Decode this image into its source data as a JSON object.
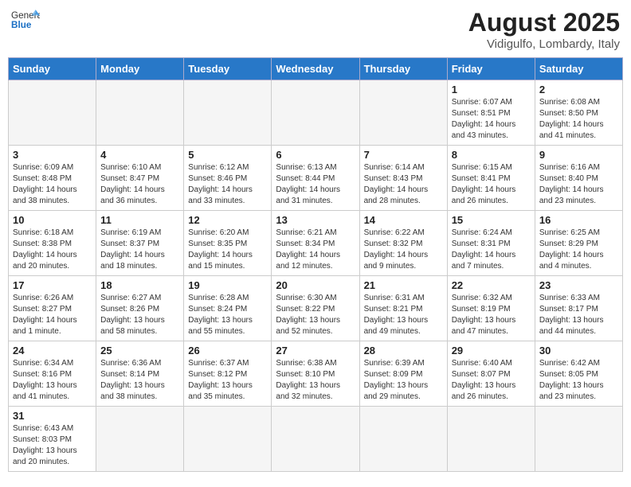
{
  "header": {
    "logo_general": "General",
    "logo_blue": "Blue",
    "title": "August 2025",
    "subtitle": "Vidigulfo, Lombardy, Italy"
  },
  "weekdays": [
    "Sunday",
    "Monday",
    "Tuesday",
    "Wednesday",
    "Thursday",
    "Friday",
    "Saturday"
  ],
  "weeks": [
    [
      {
        "day": "",
        "info": ""
      },
      {
        "day": "",
        "info": ""
      },
      {
        "day": "",
        "info": ""
      },
      {
        "day": "",
        "info": ""
      },
      {
        "day": "",
        "info": ""
      },
      {
        "day": "1",
        "info": "Sunrise: 6:07 AM\nSunset: 8:51 PM\nDaylight: 14 hours and 43 minutes."
      },
      {
        "day": "2",
        "info": "Sunrise: 6:08 AM\nSunset: 8:50 PM\nDaylight: 14 hours and 41 minutes."
      }
    ],
    [
      {
        "day": "3",
        "info": "Sunrise: 6:09 AM\nSunset: 8:48 PM\nDaylight: 14 hours and 38 minutes."
      },
      {
        "day": "4",
        "info": "Sunrise: 6:10 AM\nSunset: 8:47 PM\nDaylight: 14 hours and 36 minutes."
      },
      {
        "day": "5",
        "info": "Sunrise: 6:12 AM\nSunset: 8:46 PM\nDaylight: 14 hours and 33 minutes."
      },
      {
        "day": "6",
        "info": "Sunrise: 6:13 AM\nSunset: 8:44 PM\nDaylight: 14 hours and 31 minutes."
      },
      {
        "day": "7",
        "info": "Sunrise: 6:14 AM\nSunset: 8:43 PM\nDaylight: 14 hours and 28 minutes."
      },
      {
        "day": "8",
        "info": "Sunrise: 6:15 AM\nSunset: 8:41 PM\nDaylight: 14 hours and 26 minutes."
      },
      {
        "day": "9",
        "info": "Sunrise: 6:16 AM\nSunset: 8:40 PM\nDaylight: 14 hours and 23 minutes."
      }
    ],
    [
      {
        "day": "10",
        "info": "Sunrise: 6:18 AM\nSunset: 8:38 PM\nDaylight: 14 hours and 20 minutes."
      },
      {
        "day": "11",
        "info": "Sunrise: 6:19 AM\nSunset: 8:37 PM\nDaylight: 14 hours and 18 minutes."
      },
      {
        "day": "12",
        "info": "Sunrise: 6:20 AM\nSunset: 8:35 PM\nDaylight: 14 hours and 15 minutes."
      },
      {
        "day": "13",
        "info": "Sunrise: 6:21 AM\nSunset: 8:34 PM\nDaylight: 14 hours and 12 minutes."
      },
      {
        "day": "14",
        "info": "Sunrise: 6:22 AM\nSunset: 8:32 PM\nDaylight: 14 hours and 9 minutes."
      },
      {
        "day": "15",
        "info": "Sunrise: 6:24 AM\nSunset: 8:31 PM\nDaylight: 14 hours and 7 minutes."
      },
      {
        "day": "16",
        "info": "Sunrise: 6:25 AM\nSunset: 8:29 PM\nDaylight: 14 hours and 4 minutes."
      }
    ],
    [
      {
        "day": "17",
        "info": "Sunrise: 6:26 AM\nSunset: 8:27 PM\nDaylight: 14 hours and 1 minute."
      },
      {
        "day": "18",
        "info": "Sunrise: 6:27 AM\nSunset: 8:26 PM\nDaylight: 13 hours and 58 minutes."
      },
      {
        "day": "19",
        "info": "Sunrise: 6:28 AM\nSunset: 8:24 PM\nDaylight: 13 hours and 55 minutes."
      },
      {
        "day": "20",
        "info": "Sunrise: 6:30 AM\nSunset: 8:22 PM\nDaylight: 13 hours and 52 minutes."
      },
      {
        "day": "21",
        "info": "Sunrise: 6:31 AM\nSunset: 8:21 PM\nDaylight: 13 hours and 49 minutes."
      },
      {
        "day": "22",
        "info": "Sunrise: 6:32 AM\nSunset: 8:19 PM\nDaylight: 13 hours and 47 minutes."
      },
      {
        "day": "23",
        "info": "Sunrise: 6:33 AM\nSunset: 8:17 PM\nDaylight: 13 hours and 44 minutes."
      }
    ],
    [
      {
        "day": "24",
        "info": "Sunrise: 6:34 AM\nSunset: 8:16 PM\nDaylight: 13 hours and 41 minutes."
      },
      {
        "day": "25",
        "info": "Sunrise: 6:36 AM\nSunset: 8:14 PM\nDaylight: 13 hours and 38 minutes."
      },
      {
        "day": "26",
        "info": "Sunrise: 6:37 AM\nSunset: 8:12 PM\nDaylight: 13 hours and 35 minutes."
      },
      {
        "day": "27",
        "info": "Sunrise: 6:38 AM\nSunset: 8:10 PM\nDaylight: 13 hours and 32 minutes."
      },
      {
        "day": "28",
        "info": "Sunrise: 6:39 AM\nSunset: 8:09 PM\nDaylight: 13 hours and 29 minutes."
      },
      {
        "day": "29",
        "info": "Sunrise: 6:40 AM\nSunset: 8:07 PM\nDaylight: 13 hours and 26 minutes."
      },
      {
        "day": "30",
        "info": "Sunrise: 6:42 AM\nSunset: 8:05 PM\nDaylight: 13 hours and 23 minutes."
      }
    ],
    [
      {
        "day": "31",
        "info": "Sunrise: 6:43 AM\nSunset: 8:03 PM\nDaylight: 13 hours and 20 minutes."
      },
      {
        "day": "",
        "info": ""
      },
      {
        "day": "",
        "info": ""
      },
      {
        "day": "",
        "info": ""
      },
      {
        "day": "",
        "info": ""
      },
      {
        "day": "",
        "info": ""
      },
      {
        "day": "",
        "info": ""
      }
    ]
  ]
}
